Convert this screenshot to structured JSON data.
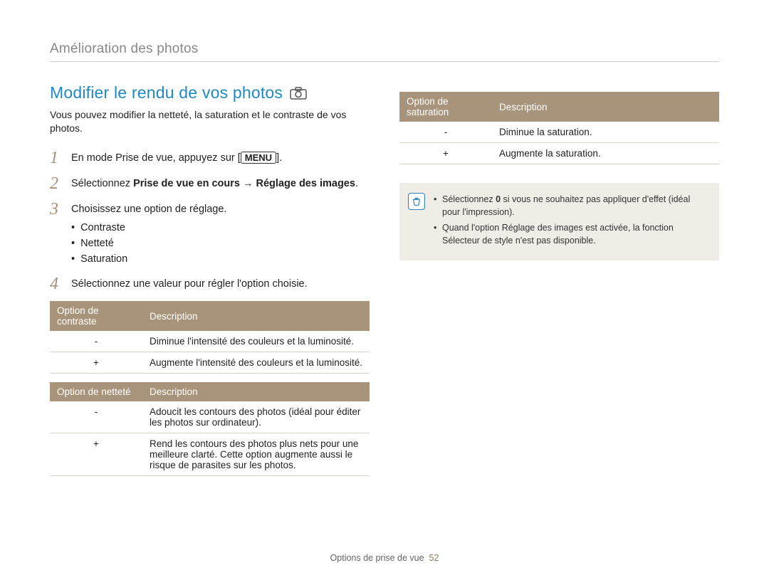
{
  "page_header": "Amélioration des photos",
  "section_title": "Modifier le rendu de vos photos",
  "icon_name": "camera-icon",
  "intro": "Vous pouvez modifier la netteté, la saturation et le contraste de vos photos.",
  "steps": {
    "s1_pre": "En mode Prise de vue, appuyez sur [",
    "s1_kbd": "MENU",
    "s1_post": "].",
    "s2_pre": "Sélectionnez ",
    "s2_bold": "Prise de vue en cours → Réglage des images",
    "s2_post": ".",
    "s3": "Choisissez une option de réglage.",
    "s3_bullets": [
      "Contraste",
      "Netteté",
      "Saturation"
    ],
    "s4": "Sélectionnez une valeur pour régler l'option choisie."
  },
  "tables": {
    "contrast": {
      "head_opt": "Option de contraste",
      "head_desc": "Description",
      "rows": [
        {
          "sign": "-",
          "desc": "Diminue l'intensité des couleurs et la luminosité."
        },
        {
          "sign": "+",
          "desc": "Augmente l'intensité des couleurs et la luminosité."
        }
      ]
    },
    "sharpness": {
      "head_opt": "Option de netteté",
      "head_desc": "Description",
      "rows": [
        {
          "sign": "-",
          "desc": "Adoucit les contours des photos (idéal pour éditer les photos sur ordinateur)."
        },
        {
          "sign": "+",
          "desc": "Rend les contours des photos plus nets pour une meilleure clarté. Cette option augmente aussi le risque de parasites sur les photos."
        }
      ]
    },
    "saturation": {
      "head_opt": "Option de saturation",
      "head_desc": "Description",
      "rows": [
        {
          "sign": "-",
          "desc": "Diminue la saturation."
        },
        {
          "sign": "+",
          "desc": "Augmente la saturation."
        }
      ]
    }
  },
  "notes": {
    "n1_pre": "Sélectionnez ",
    "n1_bold": "0",
    "n1_post": " si vous ne souhaitez pas appliquer d'effet (idéal pour l'impression).",
    "n2": "Quand l'option Réglage des images est activée, la fonction Sélecteur de style n'est pas disponible."
  },
  "footer": {
    "text": "Options de prise de vue",
    "page": "52"
  }
}
